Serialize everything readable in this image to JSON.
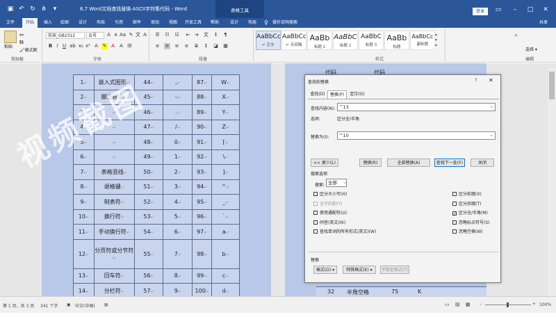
{
  "title": "6.7 Word文档查找替换-ASCII字符集代码 - Word",
  "context_tab_label": "表格工具",
  "login_label": "登录",
  "tabs": [
    {
      "label": "文件"
    },
    {
      "label": "开始"
    },
    {
      "label": "插入"
    },
    {
      "label": "绘图"
    },
    {
      "label": "设计"
    },
    {
      "label": "布局"
    },
    {
      "label": "引用"
    },
    {
      "label": "邮件"
    },
    {
      "label": "审阅"
    },
    {
      "label": "视图"
    },
    {
      "label": "开发工具"
    },
    {
      "label": "帮助"
    },
    {
      "label": "设计"
    },
    {
      "label": "布局"
    }
  ],
  "tell_me": "操作说明搜索",
  "share": "共享",
  "ribbon": {
    "paste": "粘贴",
    "format_painter": "格式刷",
    "clipboard": "剪贴板",
    "font_name": "仿宋_GB2312",
    "font_size": "五号",
    "font_group": "字体",
    "paragraph_group": "段落",
    "styles_group": "样式",
    "editing_group": "编辑",
    "select": "选择",
    "styles": [
      {
        "sample": "AaBbCcD",
        "name": "↵ 正文"
      },
      {
        "sample": "AaBbCcD",
        "name": "↵ 无间隔"
      },
      {
        "sample": "AaBb",
        "name": "标题 1"
      },
      {
        "sample": "AaBbC",
        "name": "标题 2"
      },
      {
        "sample": "AaBbC",
        "name": "标题 3"
      },
      {
        "sample": "AaBb",
        "name": "标题"
      },
      {
        "sample": "AaBbCc",
        "name": "副标题"
      }
    ]
  },
  "table_rows": [
    {
      "n": "1",
      "desc": "嵌入式图形",
      "c": "44",
      "s": ",",
      "c2": "87",
      "s2": "W"
    },
    {
      "n": "2",
      "desc": "脚注标记",
      "c": "45",
      "s": "-",
      "c2": "88",
      "s2": "X"
    },
    {
      "n": "3",
      "desc": "",
      "c": "46",
      "s": ".",
      "c2": "89",
      "s2": "Y"
    },
    {
      "n": "4",
      "desc": "",
      "c": "47",
      "s": "/",
      "c2": "90",
      "s2": "Z"
    },
    {
      "n": "5",
      "desc": "",
      "c": "48",
      "s": "0",
      "c2": "91",
      "s2": "["
    },
    {
      "n": "6",
      "desc": "",
      "c": "49",
      "s": "1",
      "c2": "92",
      "s2": "\\"
    },
    {
      "n": "7",
      "desc": "表格竖线",
      "c": "50",
      "s": "2",
      "c2": "93",
      "s2": "]"
    },
    {
      "n": "8",
      "desc": "退格键",
      "c": "51",
      "s": "3",
      "c2": "94",
      "s2": "^"
    },
    {
      "n": "9",
      "desc": "制表符",
      "c": "52",
      "s": "4",
      "c2": "95",
      "s2": "_"
    },
    {
      "n": "10",
      "desc": "换行符",
      "c": "53",
      "s": "5",
      "c2": "96",
      "s2": "`"
    },
    {
      "n": "11",
      "desc": "手动换行符",
      "c": "54",
      "s": "6",
      "c2": "97",
      "s2": "a"
    },
    {
      "n": "12",
      "desc": "分页符或分节符",
      "c": "55",
      "s": "7",
      "c2": "98",
      "s2": "b"
    },
    {
      "n": "13",
      "desc": "回车符",
      "c": "56",
      "s": "8",
      "c2": "99",
      "s2": "c"
    },
    {
      "n": "14",
      "desc": "分栏符",
      "c": "57",
      "s": "9",
      "c2": "100",
      "s2": "d"
    }
  ],
  "right_page": {
    "top_h1": "代码",
    "top_h2": "代码",
    "bottom_n": "32",
    "bottom_desc": "半角空格",
    "bottom_c": "75",
    "bottom_s": "K"
  },
  "watermark": "视频截图",
  "dialog": {
    "title": "查找和替换",
    "help": "?",
    "tabs": [
      "查找(D)",
      "替换(P)",
      "定位(G)"
    ],
    "find_label": "查找内容(N):",
    "find_value": "^13",
    "options_label": "选项:",
    "options_value": "区分全/半角",
    "replace_label": "替换为(I):",
    "replace_value": "^10",
    "less_btn": "<< 更少(L)",
    "replace_btn": "替换(R)",
    "replace_all_btn": "全部替换(A)",
    "find_next_btn": "查找下一处(F)",
    "close_btn": "关闭",
    "search_options_title": "搜索选项",
    "search_label": "搜索:",
    "search_value": "全部",
    "left_checks": [
      {
        "label": "区分大小写(H)",
        "checked": false,
        "disabled": false
      },
      {
        "label": "全字匹配(Y)",
        "checked": false,
        "disabled": true
      },
      {
        "label": "使用通配符(U)",
        "checked": false,
        "disabled": false
      },
      {
        "label": "同音(英文)(K)",
        "checked": false,
        "disabled": false
      },
      {
        "label": "查找单词的所有形式(英文)(W)",
        "checked": false,
        "disabled": false
      }
    ],
    "right_checks": [
      {
        "label": "区分前缀(X)",
        "checked": false
      },
      {
        "label": "区分后缀(T)",
        "checked": false
      },
      {
        "label": "区分全/半角(M)",
        "checked": true
      },
      {
        "label": "忽略标点符号(S)",
        "checked": false
      },
      {
        "label": "忽略空格(W)",
        "checked": false
      }
    ],
    "replace_section": "替换",
    "format_btn": "格式(O) ▾",
    "special_btn": "特殊格式(E) ▾",
    "no_format_btn": "不限定格式(T)"
  },
  "status": {
    "page": "第 1 页，共 3 页",
    "words": "341 个字",
    "lang": "中文(中国)",
    "zoom": "100%"
  }
}
